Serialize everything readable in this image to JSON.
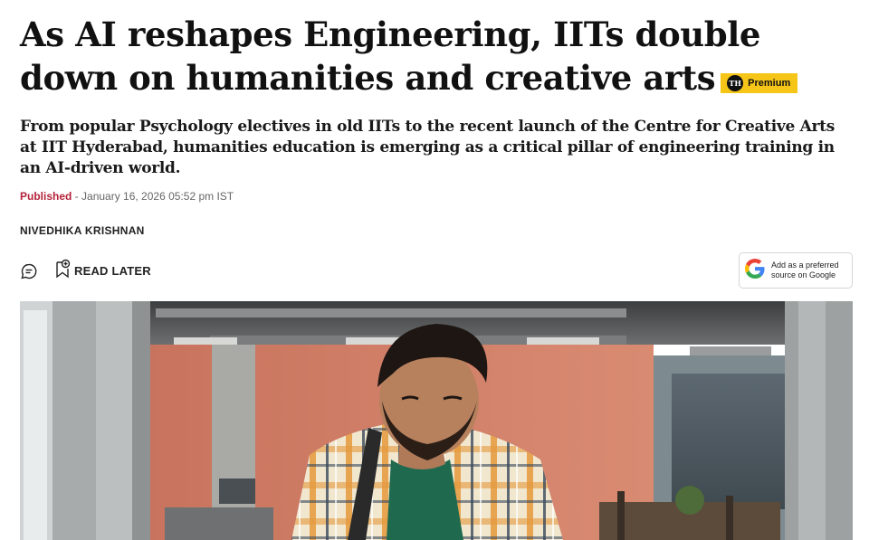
{
  "article": {
    "headline": "As AI reshapes Engineering, IITs double down on humanities and creative arts",
    "premium_badge": {
      "logo_text": "TH",
      "label": "Premium",
      "color": "#f5c518"
    },
    "summary": "From popular Psychology electives in old IITs to the recent launch of the Centre for Creative Arts at IIT Hyderabad, humanities education is emerging as a critical pillar of engineering training in an AI-driven world.",
    "published": {
      "label": "Published",
      "separator": " - ",
      "datetime": "January 16, 2026 05:52 pm IST",
      "label_color": "#b4233a"
    },
    "author": "NIVEDHIKA KRISHNAN"
  },
  "actions": {
    "comment_icon": "comment-icon",
    "read_later_icon": "bookmark-plus-icon",
    "read_later_label": "READ LATER"
  },
  "google_preferred": {
    "icon": "google-g-icon",
    "line1": "Add as a preferred",
    "line2": "source on Google"
  },
  "hero_image": {
    "subject": "student-with-backpack-photo"
  }
}
